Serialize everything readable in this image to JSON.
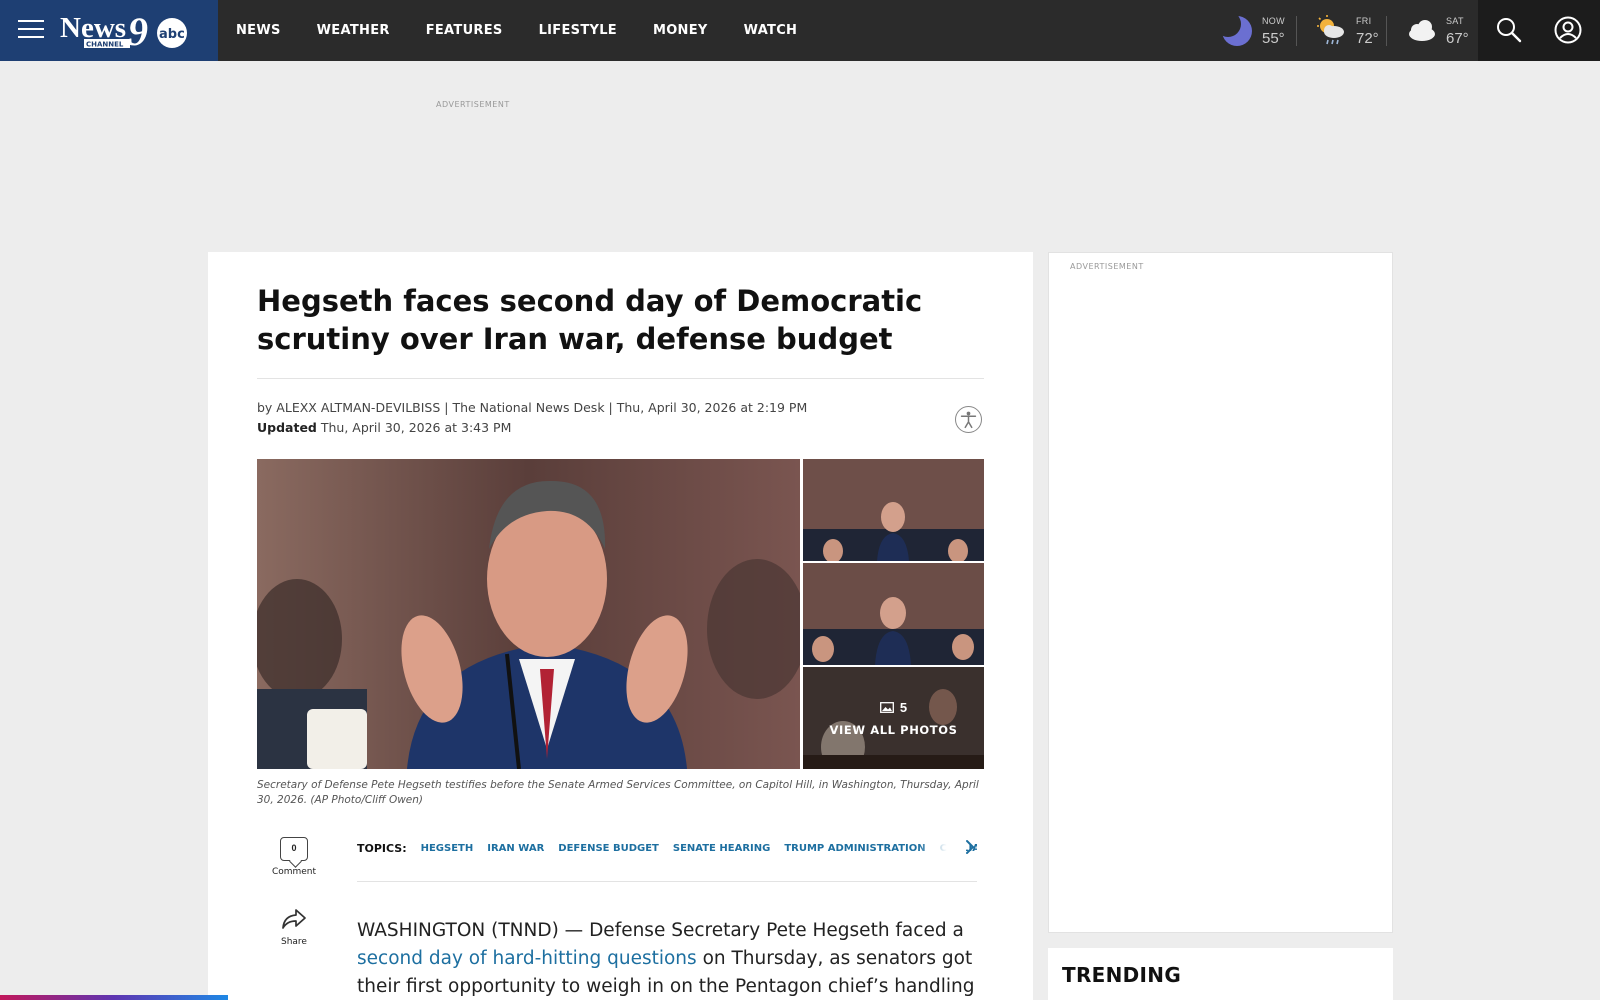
{
  "header": {
    "logo_text": "NewsChannel 9 abc",
    "nav": [
      "NEWS",
      "WEATHER",
      "FEATURES",
      "LIFESTYLE",
      "MONEY",
      "WATCH"
    ],
    "weather": [
      {
        "label": "NOW",
        "temp": "55°",
        "icon": "moon-icon"
      },
      {
        "label": "FRI",
        "temp": "72°",
        "icon": "sun-rain-icon"
      },
      {
        "label": "SAT",
        "temp": "67°",
        "icon": "cloud-icon"
      }
    ],
    "icons": [
      "menu-icon",
      "search-icon",
      "account-icon"
    ]
  },
  "ads": {
    "top_label": "ADVERTISEMENT",
    "rail_label": "ADVERTISEMENT"
  },
  "article": {
    "headline": "Hegseth faces second day of Democratic scrutiny over Iran war, defense budget",
    "byline": "by ALEXX ALTMAN-DEVILBISS | The National News Desk | Thu, April 30, 2026 at 2:19 PM",
    "updated_label": "Updated",
    "updated_time": "Thu, April 30, 2026 at 3:43 PM",
    "gallery": {
      "photo_count": "5",
      "view_all_label": "VIEW ALL PHOTOS"
    },
    "caption": "Secretary of Defense Pete Hegseth testifies before the Senate Armed Services Committee, on Capitol Hill, in Washington, Thursday, April 30, 2026. (AP Photo/Cliff Owen)",
    "comment_count": "0",
    "comment_label": "Comment",
    "share_label": "Share",
    "topics_label": "TOPICS:",
    "topics": [
      "HEGSETH",
      "IRAN WAR",
      "DEFENSE BUDGET",
      "SENATE HEARING",
      "TRUMP ADMINISTRATION",
      "CIVILIAN CAS"
    ],
    "body_lead": "WASHINGTON (TNND) — Defense Secretary Pete Hegseth faced a",
    "body_link": "second day of hard-hitting questions",
    "body_rest": "on Thursday, as senators got their first opportunity to weigh in on the Pentagon chief’s handling of the Iran"
  },
  "rail": {
    "trending_title": "TRENDING"
  },
  "colors": {
    "brand_blue": "#1e3f73",
    "header_bg": "#2b2b2b",
    "link_blue": "#1d6fa0"
  }
}
